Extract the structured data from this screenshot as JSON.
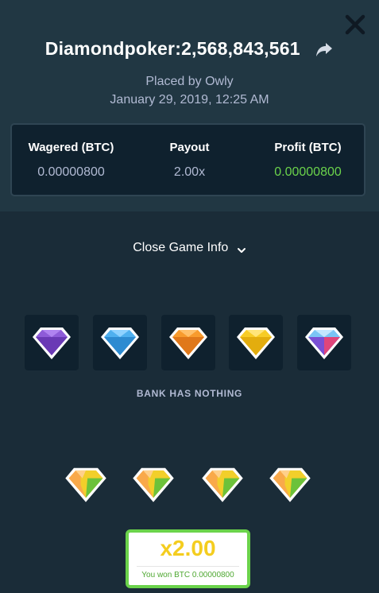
{
  "header": {
    "title": "Diamondpoker:2,568,843,561",
    "placed_by": "Placed by Owly",
    "date": "January 29, 2019, 12:25 AM"
  },
  "stats": [
    {
      "label": "Wagered (BTC)",
      "value": "0.00000800"
    },
    {
      "label": "Payout",
      "value": "2.00x"
    },
    {
      "label": "Profit (BTC)",
      "value": "0.00000800"
    }
  ],
  "toggle_label": "Close Game Info",
  "dealer_gems": [
    "purple",
    "blue",
    "orange",
    "yellow",
    "pink-blue"
  ],
  "bank_result": "BANK HAS NOTHING",
  "player_gems": [
    "orange-green",
    "orange-green",
    "orange-green",
    "orange-green"
  ],
  "payout": {
    "multiplier": "x2.00",
    "win_text": "You won BTC 0.00000800"
  },
  "colors": {
    "background": "#1a2c38",
    "panel": "#213743",
    "profit_green": "#6bd34b",
    "payout_yellow": "#f4cd1f"
  }
}
